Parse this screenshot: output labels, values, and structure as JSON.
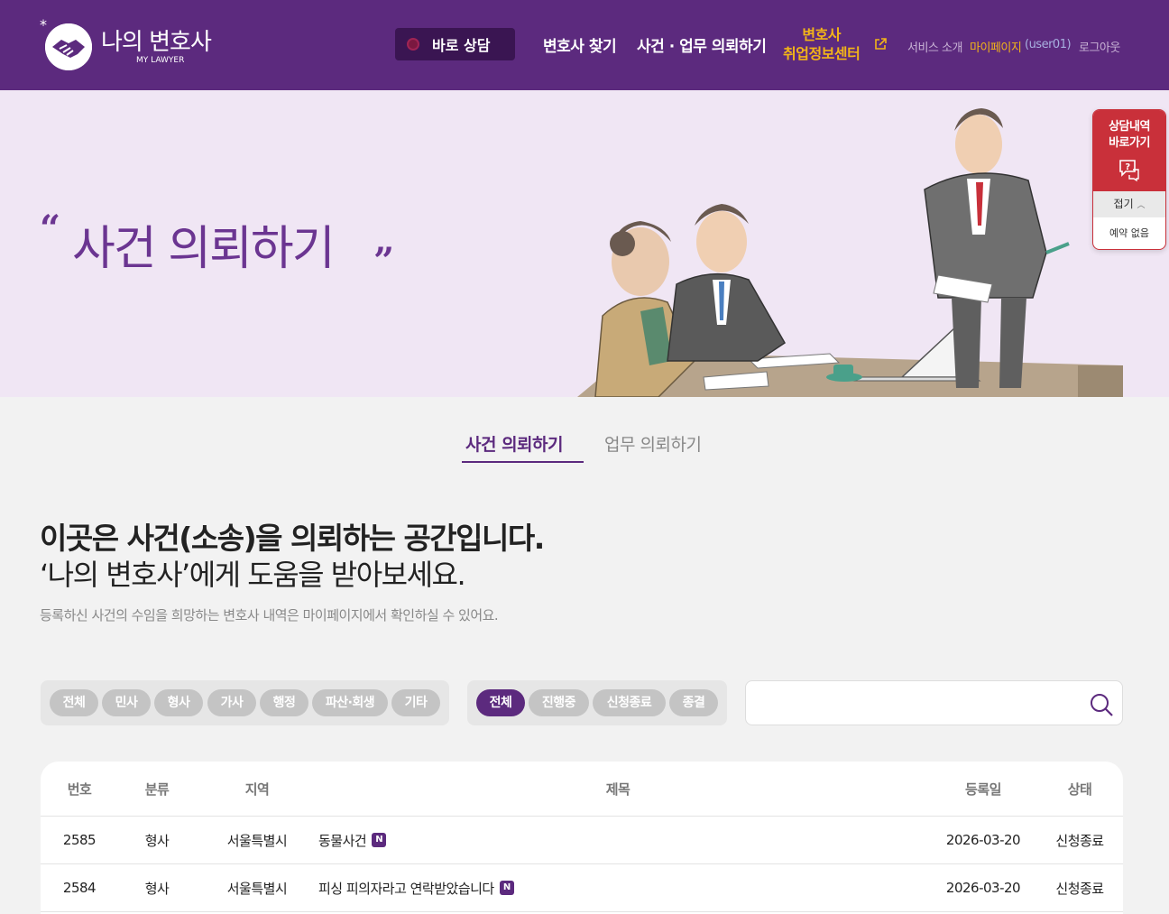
{
  "header": {
    "logo_title": "나의 변호사",
    "logo_sub": "MY LAWYER",
    "quick_consult": "바로 상담",
    "nav": [
      "변호사 찾기",
      "사건 · 업무 의뢰하기"
    ],
    "jobs_line1": "변호사",
    "jobs_line2": "취업정보센터",
    "util": {
      "service": "서비스 소개",
      "mypage": "마이페이지",
      "user": "(user01)",
      "logout": "로그아웃"
    }
  },
  "hero": {
    "title": "사건 의뢰하기"
  },
  "floating": {
    "title_line1": "상담내역",
    "title_line2": "바로가기",
    "fold": "접기",
    "empty": "예약 없음"
  },
  "tabs": {
    "active": "사건 의뢰하기",
    "other": "업무 의뢰하기"
  },
  "intro": {
    "heading": "이곳은 사건(소송)을 의뢰하는 공간입니다.",
    "subheading": "‘나의 변호사’에게 도움을 받아보세요.",
    "description": "등록하신 사건의 수임을 희망하는 변호사 내역은 마이페이지에서 확인하실 수 있어요."
  },
  "filters": {
    "category": [
      "전체",
      "민사",
      "형사",
      "가사",
      "행정",
      "파산·회생",
      "기타"
    ],
    "status": [
      "전체",
      "진행중",
      "신청종료",
      "종결"
    ]
  },
  "search": {
    "placeholder": ""
  },
  "table": {
    "headers": {
      "no": "번호",
      "category": "분류",
      "region": "지역",
      "title": "제목",
      "date": "등록일",
      "status": "상태"
    },
    "rows": [
      {
        "no": "2585",
        "category": "형사",
        "region": "서울특별시",
        "title": "동물사건",
        "badge": "N",
        "date": "2026-03-20",
        "status": "신청종료"
      },
      {
        "no": "2584",
        "category": "형사",
        "region": "서울특별시",
        "title": "피싱 피의자라고 연락받았습니다",
        "badge": "N",
        "date": "2026-03-20",
        "status": "신청종료"
      }
    ]
  },
  "colors": {
    "brand": "#5c2a7e",
    "accent_yellow": "#f2b418",
    "float_red": "#c9303a",
    "hero_bg": "#f0e6f4"
  }
}
